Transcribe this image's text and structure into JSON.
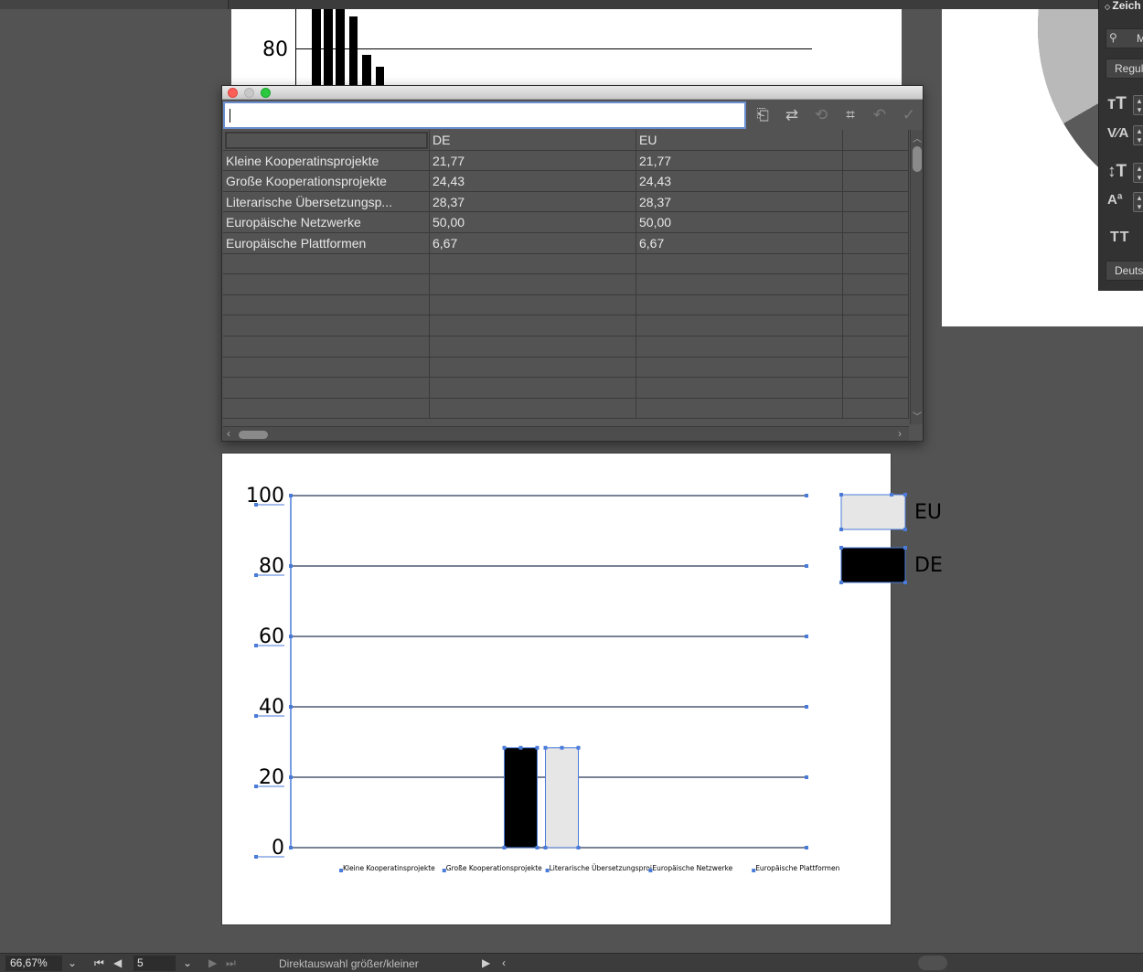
{
  "workspace": {
    "background_top_chart": {
      "ytick": "80"
    }
  },
  "char_panel": {
    "title": "Zeich",
    "font_search": "M",
    "font_style": "Regul",
    "language": "Deuts",
    "caps_icon": "TT"
  },
  "data_window": {
    "entry_value": "",
    "columns": [
      "",
      "DE",
      "EU"
    ],
    "rows": [
      [
        "Kleine Kooperatinsprojekte",
        "21,77",
        "21,77"
      ],
      [
        "Große Kooperationsprojekte",
        "24,43",
        "24,43"
      ],
      [
        "Literarische Übersetzungsp...",
        "28,37",
        "28,37"
      ],
      [
        "Europäische Netzwerke",
        "50,00",
        "50,00"
      ],
      [
        "Europäische Plattformen",
        "6,67",
        "6,67"
      ]
    ],
    "empty_rows": 8
  },
  "chart_data": {
    "type": "bar",
    "categories": [
      "Kleine Kooperatinsprojekte",
      "Große Kooperationsprojekte",
      "Literarische Übersetzungsprojekte",
      "Europäische Netzwerke",
      "Europäische Plattformen"
    ],
    "visible_category_labels": [
      "Kleine Kooperatinsprojekte",
      "Große Kooperationsprojekte",
      "Literarische Übersetzungsproj",
      "Europäische Netzwerke",
      "Europäische Plattformen"
    ],
    "series": [
      {
        "name": "DE",
        "color": "#000000",
        "values": [
          null,
          null,
          28.37,
          null,
          null
        ]
      },
      {
        "name": "EU",
        "color": "#e6e6e6",
        "values": [
          null,
          null,
          28.37,
          null,
          null
        ]
      }
    ],
    "yticks": [
      "0",
      "20",
      "40",
      "60",
      "80",
      "100"
    ],
    "ylim": [
      0,
      100
    ],
    "grid": true,
    "legend": {
      "position": "right",
      "entries": [
        "EU",
        "DE"
      ]
    },
    "title": "",
    "xlabel": "",
    "ylabel": ""
  },
  "statusbar": {
    "zoom": "66,67%",
    "page": "5",
    "hint": "Direktauswahl größer/kleiner"
  },
  "colors": {
    "selection": "#4a7bd9",
    "ui_dark": "#323232",
    "canvas": "#535353"
  }
}
